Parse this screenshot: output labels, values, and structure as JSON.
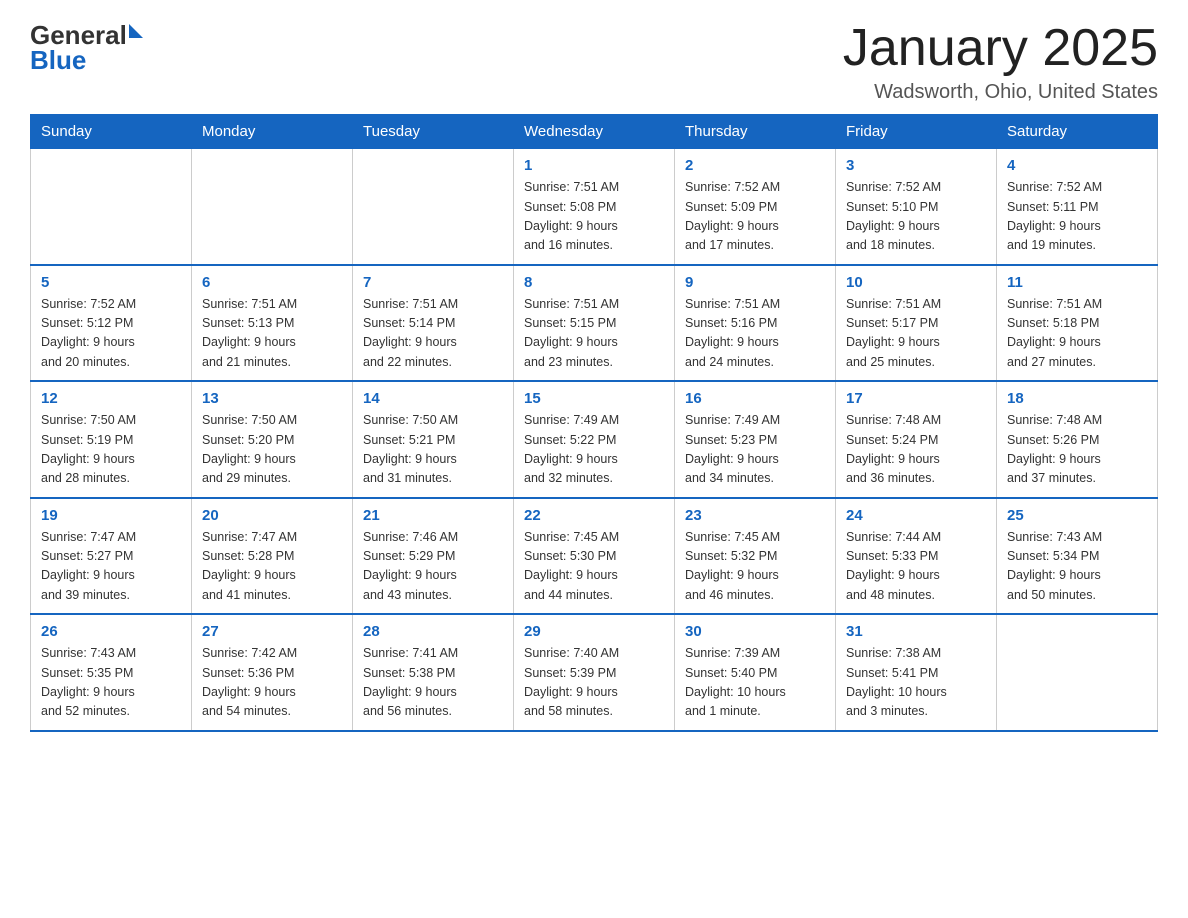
{
  "header": {
    "logo_general": "General",
    "logo_blue": "Blue",
    "month_title": "January 2025",
    "location": "Wadsworth, Ohio, United States"
  },
  "days_of_week": [
    "Sunday",
    "Monday",
    "Tuesday",
    "Wednesday",
    "Thursday",
    "Friday",
    "Saturday"
  ],
  "weeks": [
    [
      {
        "day": "",
        "info": ""
      },
      {
        "day": "",
        "info": ""
      },
      {
        "day": "",
        "info": ""
      },
      {
        "day": "1",
        "info": "Sunrise: 7:51 AM\nSunset: 5:08 PM\nDaylight: 9 hours\nand 16 minutes."
      },
      {
        "day": "2",
        "info": "Sunrise: 7:52 AM\nSunset: 5:09 PM\nDaylight: 9 hours\nand 17 minutes."
      },
      {
        "day": "3",
        "info": "Sunrise: 7:52 AM\nSunset: 5:10 PM\nDaylight: 9 hours\nand 18 minutes."
      },
      {
        "day": "4",
        "info": "Sunrise: 7:52 AM\nSunset: 5:11 PM\nDaylight: 9 hours\nand 19 minutes."
      }
    ],
    [
      {
        "day": "5",
        "info": "Sunrise: 7:52 AM\nSunset: 5:12 PM\nDaylight: 9 hours\nand 20 minutes."
      },
      {
        "day": "6",
        "info": "Sunrise: 7:51 AM\nSunset: 5:13 PM\nDaylight: 9 hours\nand 21 minutes."
      },
      {
        "day": "7",
        "info": "Sunrise: 7:51 AM\nSunset: 5:14 PM\nDaylight: 9 hours\nand 22 minutes."
      },
      {
        "day": "8",
        "info": "Sunrise: 7:51 AM\nSunset: 5:15 PM\nDaylight: 9 hours\nand 23 minutes."
      },
      {
        "day": "9",
        "info": "Sunrise: 7:51 AM\nSunset: 5:16 PM\nDaylight: 9 hours\nand 24 minutes."
      },
      {
        "day": "10",
        "info": "Sunrise: 7:51 AM\nSunset: 5:17 PM\nDaylight: 9 hours\nand 25 minutes."
      },
      {
        "day": "11",
        "info": "Sunrise: 7:51 AM\nSunset: 5:18 PM\nDaylight: 9 hours\nand 27 minutes."
      }
    ],
    [
      {
        "day": "12",
        "info": "Sunrise: 7:50 AM\nSunset: 5:19 PM\nDaylight: 9 hours\nand 28 minutes."
      },
      {
        "day": "13",
        "info": "Sunrise: 7:50 AM\nSunset: 5:20 PM\nDaylight: 9 hours\nand 29 minutes."
      },
      {
        "day": "14",
        "info": "Sunrise: 7:50 AM\nSunset: 5:21 PM\nDaylight: 9 hours\nand 31 minutes."
      },
      {
        "day": "15",
        "info": "Sunrise: 7:49 AM\nSunset: 5:22 PM\nDaylight: 9 hours\nand 32 minutes."
      },
      {
        "day": "16",
        "info": "Sunrise: 7:49 AM\nSunset: 5:23 PM\nDaylight: 9 hours\nand 34 minutes."
      },
      {
        "day": "17",
        "info": "Sunrise: 7:48 AM\nSunset: 5:24 PM\nDaylight: 9 hours\nand 36 minutes."
      },
      {
        "day": "18",
        "info": "Sunrise: 7:48 AM\nSunset: 5:26 PM\nDaylight: 9 hours\nand 37 minutes."
      }
    ],
    [
      {
        "day": "19",
        "info": "Sunrise: 7:47 AM\nSunset: 5:27 PM\nDaylight: 9 hours\nand 39 minutes."
      },
      {
        "day": "20",
        "info": "Sunrise: 7:47 AM\nSunset: 5:28 PM\nDaylight: 9 hours\nand 41 minutes."
      },
      {
        "day": "21",
        "info": "Sunrise: 7:46 AM\nSunset: 5:29 PM\nDaylight: 9 hours\nand 43 minutes."
      },
      {
        "day": "22",
        "info": "Sunrise: 7:45 AM\nSunset: 5:30 PM\nDaylight: 9 hours\nand 44 minutes."
      },
      {
        "day": "23",
        "info": "Sunrise: 7:45 AM\nSunset: 5:32 PM\nDaylight: 9 hours\nand 46 minutes."
      },
      {
        "day": "24",
        "info": "Sunrise: 7:44 AM\nSunset: 5:33 PM\nDaylight: 9 hours\nand 48 minutes."
      },
      {
        "day": "25",
        "info": "Sunrise: 7:43 AM\nSunset: 5:34 PM\nDaylight: 9 hours\nand 50 minutes."
      }
    ],
    [
      {
        "day": "26",
        "info": "Sunrise: 7:43 AM\nSunset: 5:35 PM\nDaylight: 9 hours\nand 52 minutes."
      },
      {
        "day": "27",
        "info": "Sunrise: 7:42 AM\nSunset: 5:36 PM\nDaylight: 9 hours\nand 54 minutes."
      },
      {
        "day": "28",
        "info": "Sunrise: 7:41 AM\nSunset: 5:38 PM\nDaylight: 9 hours\nand 56 minutes."
      },
      {
        "day": "29",
        "info": "Sunrise: 7:40 AM\nSunset: 5:39 PM\nDaylight: 9 hours\nand 58 minutes."
      },
      {
        "day": "30",
        "info": "Sunrise: 7:39 AM\nSunset: 5:40 PM\nDaylight: 10 hours\nand 1 minute."
      },
      {
        "day": "31",
        "info": "Sunrise: 7:38 AM\nSunset: 5:41 PM\nDaylight: 10 hours\nand 3 minutes."
      },
      {
        "day": "",
        "info": ""
      }
    ]
  ]
}
